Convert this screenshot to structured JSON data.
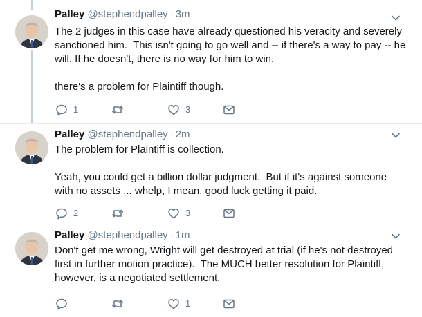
{
  "tweets": [
    {
      "name": "Palley",
      "handle": "@stephendpalley",
      "separator": "·",
      "time": "3m",
      "text": "The 2 judges in this case have already questioned his veracity and severely sanctioned him.  This isn't going to go well and -- if there's a way to pay -- he will. If he doesn't, there is no way for him to win.\n\nthere's a problem for Plaintiff though.",
      "reply_count": "1",
      "retweet_count": "",
      "like_count": "3"
    },
    {
      "name": "Palley",
      "handle": "@stephendpalley",
      "separator": "·",
      "time": "2m",
      "text": "The problem for Plaintiff is collection.\n\nYeah, you could get a billion dollar judgment.  But if it's against someone with no assets ... whelp, I mean, good luck getting it paid.",
      "reply_count": "2",
      "retweet_count": "",
      "like_count": "3"
    },
    {
      "name": "Palley",
      "handle": "@stephendpalley",
      "separator": "·",
      "time": "1m",
      "text": "Don't get me wrong, Wright will get destroyed at trial (if he's not destroyed first in further motion practice).  The MUCH better resolution for Plaintiff, however, is a negotiated settlement.",
      "reply_count": "",
      "retweet_count": "",
      "like_count": "1"
    }
  ],
  "icons": {
    "reply": "speech-bubble-icon",
    "retweet": "retweet-arrows-icon",
    "like": "heart-icon",
    "direct_message": "envelope-icon",
    "more": "chevron-down-icon"
  },
  "colors": {
    "text": "#14171a",
    "secondary": "#657786",
    "divider": "#e6ecf0",
    "thread_line": "#c4cfd6"
  }
}
